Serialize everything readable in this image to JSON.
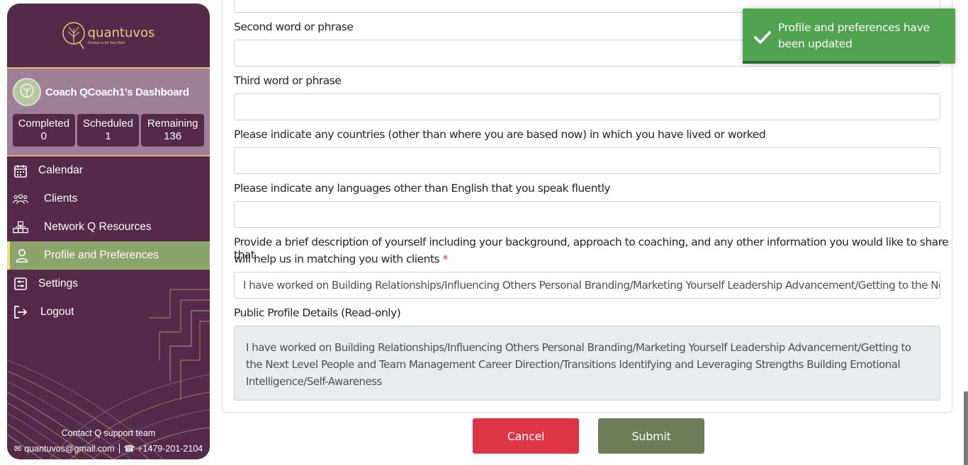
{
  "brand": {
    "name": "quantuvos",
    "tagline": "Choose to be Your Best",
    "accent": "#e4b86a",
    "sidebar_bg": "#55294a"
  },
  "dashboard": {
    "title": "Coach QCoach1's Dashboard",
    "stats": [
      {
        "label": "Completed",
        "value": "0"
      },
      {
        "label": "Scheduled",
        "value": "1"
      },
      {
        "label": "Remaining",
        "value": "136"
      }
    ]
  },
  "nav": [
    {
      "label": "Calendar",
      "icon": "calendar-icon"
    },
    {
      "label": "Clients",
      "icon": "users-icon"
    },
    {
      "label": "Network Q Resources",
      "icon": "network-icon"
    },
    {
      "label": "Profile and Preferences",
      "icon": "user-icon",
      "active": true
    },
    {
      "label": "Settings",
      "icon": "settings-icon"
    },
    {
      "label": "Logout",
      "icon": "logout-icon"
    }
  ],
  "contact": {
    "title": "Contact Q support team",
    "email": "quantuvos@gmail.com",
    "phone": "+1479-201-2104"
  },
  "form": {
    "second_label": "Second word or phrase",
    "third_label": "Third word or phrase",
    "countries_label": "Please indicate any countries (other than where you are based now) in which you have lived or worked",
    "languages_label": "Please indicate any languages other than English that you speak fluently",
    "description_label_line1": "Provide a brief description of yourself including your background, approach to coaching, and any other information you would like to share that",
    "description_label_line2": "will help us in matching you with clients",
    "required_mark": "*",
    "description_value": "I have worked on Building Relationships/Influencing Others Personal Branding/Marketing Yourself Leadership Advancement/Getting to the Next Level People and Team Management Career Direction/Transitions Identifying and Leveraging Strengths Building Emotional Intelligence/Self-Awareness",
    "public_label": "Public Profile Details (Read-only)",
    "public_value": "I have worked on Building Relationships/Influencing Others Personal Branding/Marketing Yourself Leadership Advancement/Getting to the Next Level People and Team Management Career Direction/Transitions Identifying and Leveraging Strengths Building Emotional Intelligence/Self-Awareness"
  },
  "buttons": {
    "cancel": "Cancel",
    "submit": "Submit"
  },
  "toast": {
    "message": "Profile and preferences have been updated",
    "color": "#51a351"
  }
}
